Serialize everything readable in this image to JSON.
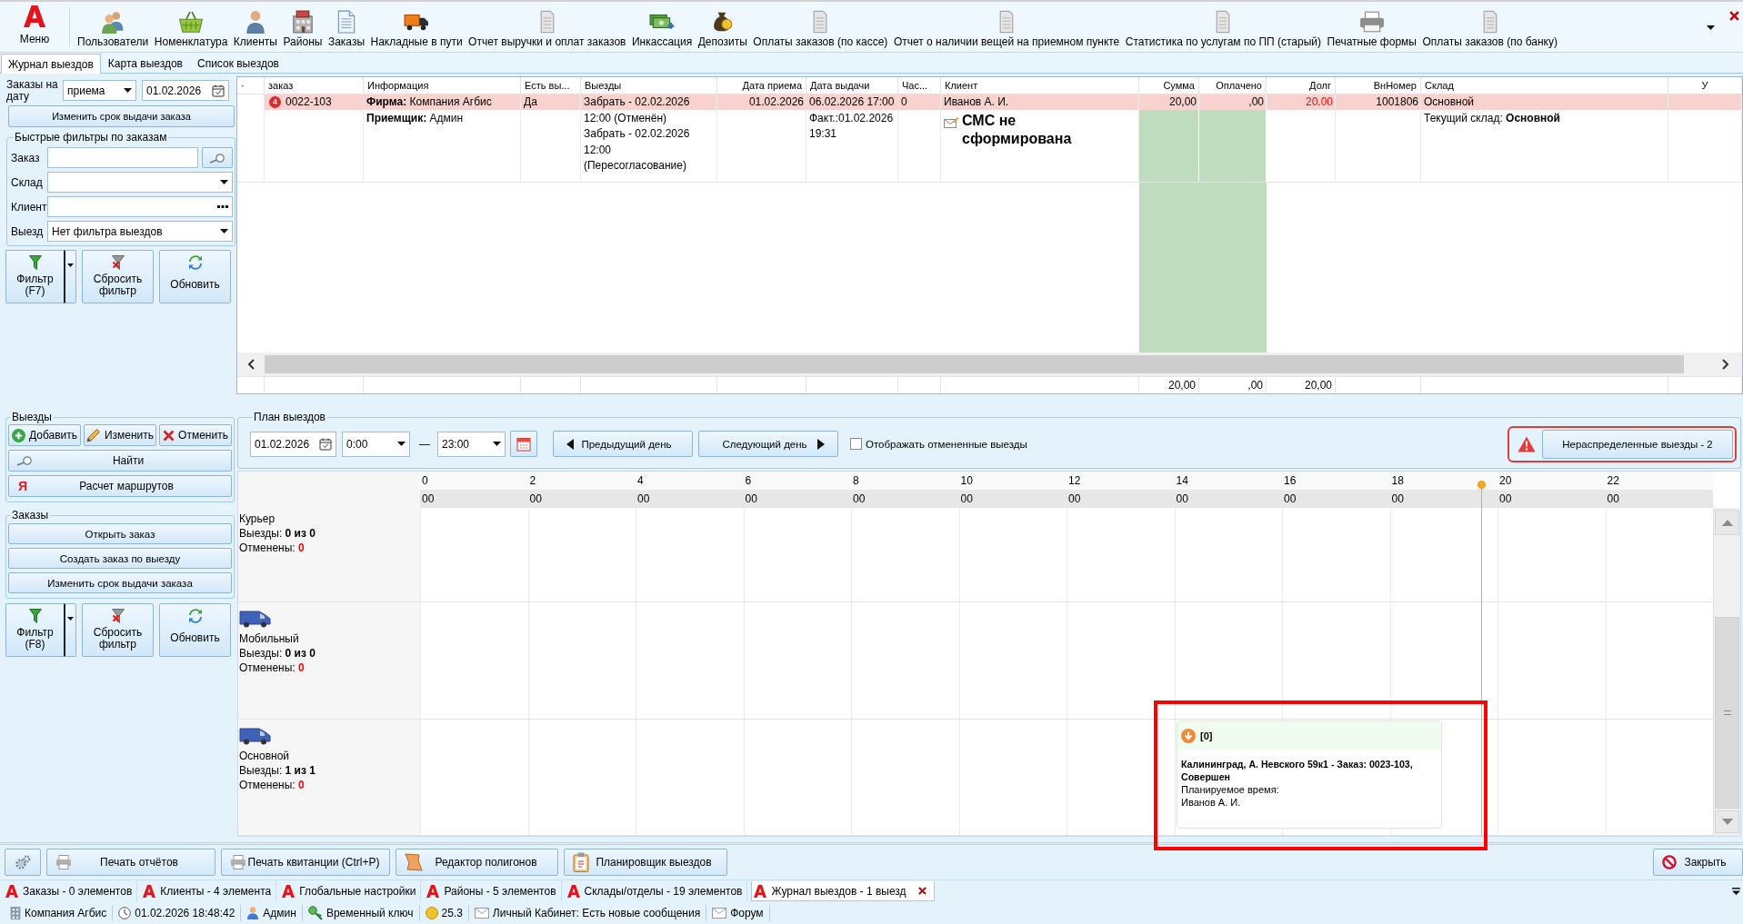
{
  "toolbar": {
    "menu": "Меню",
    "items": [
      "Пользователи",
      "Номенклатура",
      "Клиенты",
      "Районы",
      "Заказы",
      "Накладные в пути",
      "Отчет выручки и оплат заказов",
      "Инкассация",
      "Депозиты",
      "Оплаты заказов (по кассе)",
      "Отчет о наличии вещей на приемном пункте",
      "Статистика по услугам по ПП (старый)",
      "Печатные формы",
      "Оплаты заказов (по банку)"
    ]
  },
  "view_tabs": [
    {
      "label": "Журнал выездов",
      "selected": true
    },
    {
      "label": "Карта выездов",
      "selected": false
    },
    {
      "label": "Список выездов",
      "selected": false
    }
  ],
  "order_filter": {
    "date_label": "Заказы на дату",
    "date_type": "приема",
    "date": "01.02.2026",
    "change_due_button": "Изменить срок выдачи заказа",
    "quick_filters": {
      "title": "Быстрые фильтры по заказам",
      "fields": [
        {
          "label": "Заказ",
          "kind": "search"
        },
        {
          "label": "Склад",
          "kind": "dropdown"
        },
        {
          "label": "Клиент",
          "kind": "picker"
        },
        {
          "label": "Выезд",
          "kind": "dropdown",
          "value": "Нет фильтра выездов"
        }
      ]
    },
    "buttons": [
      {
        "label": "Фильтр (F7)",
        "kind": "split"
      },
      {
        "label": "Сбросить фильтр",
        "kind": "plain"
      },
      {
        "label": "Обновить",
        "kind": "plain"
      }
    ]
  },
  "orders_table": {
    "columns": [
      {
        "title": "·"
      },
      {
        "title": "заказ"
      },
      {
        "title": "Информация"
      },
      {
        "title": "Есть вы..."
      },
      {
        "title": "Выезды"
      },
      {
        "title": "Дата приема"
      },
      {
        "title": "Дата выдачи"
      },
      {
        "title": "Час..."
      },
      {
        "title": "Клиент"
      },
      {
        "title": "Сумма",
        "highlighted": true
      },
      {
        "title": "Оплачено",
        "highlighted": true
      },
      {
        "title": "Долг"
      },
      {
        "title": "ВнНомер"
      },
      {
        "title": "Склад"
      },
      {
        "title": "У"
      }
    ],
    "rows": [
      {
        "selected": true,
        "badge": "4",
        "order": "0022-103",
        "info": [
          "**Фирма:** Компания Агбис",
          "**Приемщик:** Админ"
        ],
        "has_trips": "Да",
        "trips": [
          "Забрать - 02.02.2026 12:00 (Отменён)",
          "Забрать - 02.02.2026 12:00 (Пересогласование)"
        ],
        "received": "01.02.2026",
        "due": [
          "06.02.2026 17:00",
          "Факт.:01.02.2026 19:31"
        ],
        "hours": "0",
        "client": "Иванов А. И.",
        "sms_status": "СМС не сформирована",
        "sum": "20,00",
        "paid": ",00",
        "debt": "20.00",
        "debt_alert": true,
        "internal_number": "1001806",
        "warehouse": "Основной",
        "current_warehouse": "Текущий склад: **Основной**"
      }
    ],
    "totals": {
      "sum": "20,00",
      "paid": ",00",
      "debt": "20,00"
    }
  },
  "trips_panel": {
    "title": "Выезды",
    "buttons": [
      "Добавить",
      "Изменить",
      "Отменить"
    ],
    "find_button": "Найти",
    "route_button": {
      "glyph": "Я",
      "label": "Расчет маршрутов"
    }
  },
  "orders_panel": {
    "title": "Заказы",
    "buttons": [
      "Открыть заказ",
      "Создать заказ по выезду",
      "Изменить срок выдачи заказа"
    ]
  },
  "trip_filter_buttons": [
    {
      "label": "Фильтр (F8)",
      "kind": "split"
    },
    {
      "label": "Сбросить фильтр",
      "kind": "plain"
    },
    {
      "label": "Обновить",
      "kind": "plain"
    }
  ],
  "plan": {
    "title": "План выездов",
    "date": "01.02.2026",
    "time_from": "0:00",
    "separator": "—",
    "time_to": "23:00",
    "prev_day": "Предыдущий день",
    "next_day": "Следующий день",
    "show_cancelled": {
      "label": "Отображать отмененные выезды",
      "checked": false
    },
    "unassigned": {
      "label": "Нераспределенные выезды - 2",
      "alert": true
    },
    "hours": [
      {
        "hour": "0",
        "minutes": "00"
      },
      {
        "hour": "2",
        "minutes": "00"
      },
      {
        "hour": "4",
        "minutes": "00"
      },
      {
        "hour": "6",
        "minutes": "00"
      },
      {
        "hour": "8",
        "minutes": "00"
      },
      {
        "hour": "10",
        "minutes": "00"
      },
      {
        "hour": "12",
        "minutes": "00"
      },
      {
        "hour": "14",
        "minutes": "00"
      },
      {
        "hour": "16",
        "minutes": "00"
      },
      {
        "hour": "18",
        "minutes": "00"
      },
      {
        "hour": "20",
        "minutes": "00"
      },
      {
        "hour": "22",
        "minutes": "00"
      }
    ],
    "current_time": {
      "level": 0.821
    },
    "lanes": [
      {
        "kind": "courier",
        "name": "Курьер",
        "trips": "Выезды: **0 из 0**",
        "cancelled": "Отменены: **0**"
      },
      {
        "kind": "van",
        "name": "Мобильный",
        "trips": "Выезды: **0 из 0**",
        "cancelled": "Отменены: **0**"
      },
      {
        "kind": "van",
        "name": "Основной",
        "trips": "Выезды: **1 из 1**",
        "cancelled": "Отменены: **0**",
        "events": [
          {
            "highlighted": true,
            "code": "[0]",
            "title": "Калининград, А. Невского 59к1 - Заказ: 0023-103, Совершен",
            "planned_label": "Планируемое время:",
            "client": "Иванов А. И."
          }
        ]
      }
    ]
  },
  "action_buttons": [
    "Печать отчётов",
    "Печать квитанции (Ctrl+P)",
    "Редактор полигонов",
    "Планировщик выездов"
  ],
  "close_button": "Закрыть",
  "doc_tabs": [
    {
      "label": "Заказы - 0 элементов",
      "selected": false
    },
    {
      "label": "Клиенты - 4 элемента",
      "selected": false
    },
    {
      "label": "Глобальные настройки",
      "selected": false
    },
    {
      "label": "Районы - 5 элементов",
      "selected": false
    },
    {
      "label": "Склады/отделы - 19 элементов",
      "selected": false
    },
    {
      "label": "Журнал выездов - 1 выезд",
      "selected": true
    }
  ],
  "status_bar": [
    "Компания Агбис",
    "01.02.2026 18:48:42",
    "Админ",
    "Временный ключ",
    "25.3",
    "Личный Кабинет: Есть новые сообщения",
    "Форум"
  ]
}
